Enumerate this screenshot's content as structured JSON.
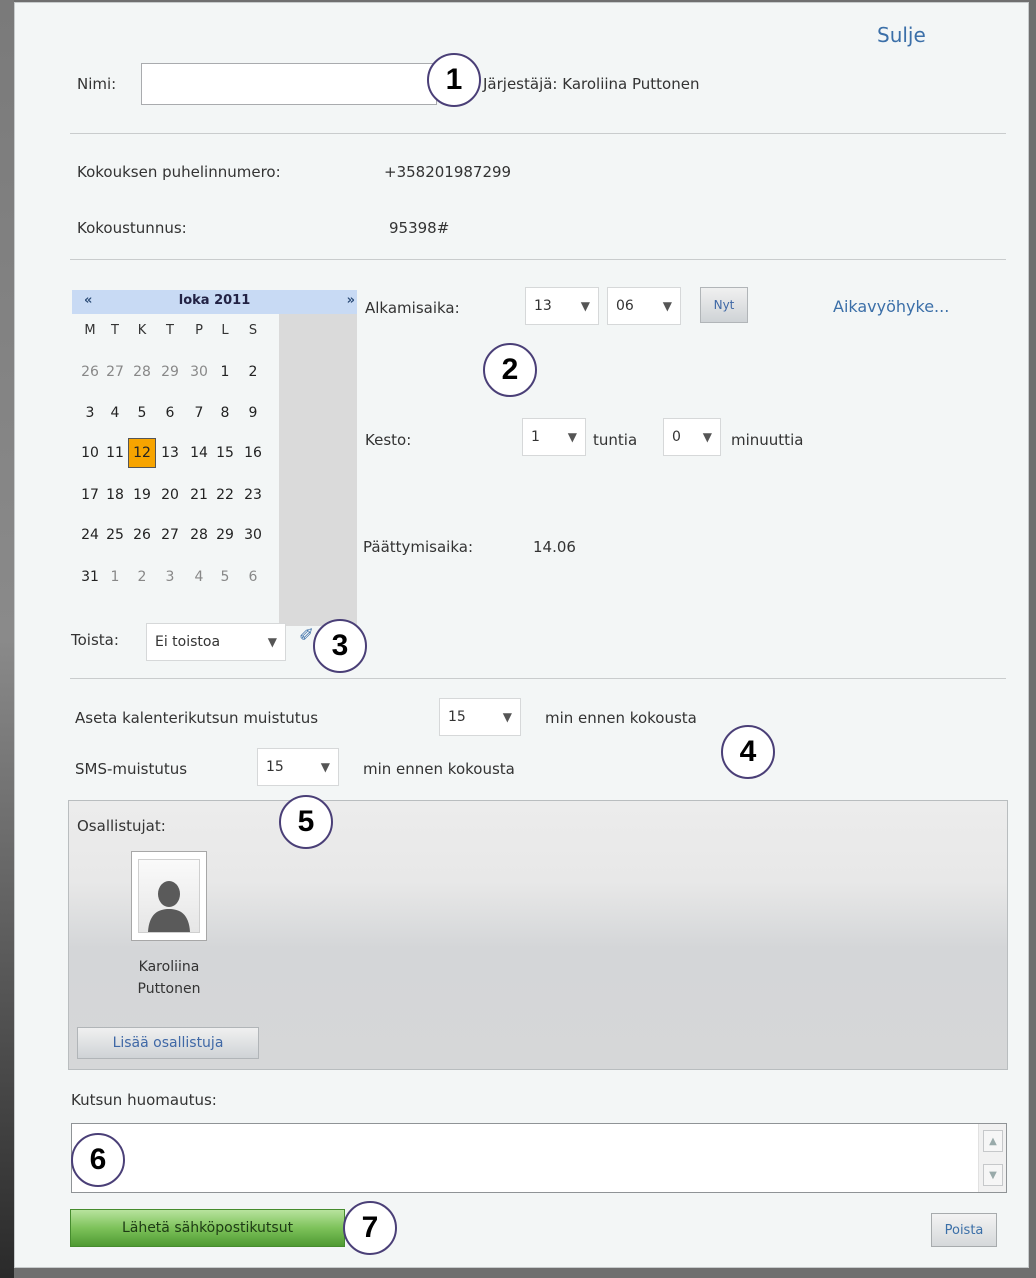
{
  "header": {
    "close_link": "Sulje"
  },
  "name": {
    "label": "Nimi:",
    "value": "",
    "organizer": "Järjestäjä: Karoliina Puttonen"
  },
  "meeting": {
    "phone_label": "Kokouksen puhelinnumero:",
    "phone_value": "+358201987299",
    "code_label": "Kokoustunnus:",
    "code_value": "95398#"
  },
  "calendar": {
    "prev": "«",
    "next": "»",
    "month_title": "loka 2011",
    "weekdays": [
      "M",
      "T",
      "K",
      "T",
      "P",
      "L",
      "S"
    ],
    "weeks": [
      [
        "26",
        "27",
        "28",
        "29",
        "30",
        "1",
        "2"
      ],
      [
        "3",
        "4",
        "5",
        "6",
        "7",
        "8",
        "9"
      ],
      [
        "10",
        "11",
        "12",
        "13",
        "14",
        "15",
        "16"
      ],
      [
        "17",
        "18",
        "19",
        "20",
        "21",
        "22",
        "23"
      ],
      [
        "24",
        "25",
        "26",
        "27",
        "28",
        "29",
        "30"
      ],
      [
        "31",
        "1",
        "2",
        "3",
        "4",
        "5",
        "6"
      ]
    ],
    "selected_day": "12"
  },
  "time": {
    "start_label": "Alkamisaika:",
    "start_hour": "13",
    "start_minute": "06",
    "now_button": "Nyt",
    "timezone_link": "Aikavyöhyke...",
    "duration_label": "Kesto:",
    "duration_hours": "1",
    "hours_unit": "tuntia",
    "duration_minutes": "0",
    "minutes_unit": "minuuttia",
    "end_label": "Päättymisaika:",
    "end_value": "14.06"
  },
  "repeat": {
    "label": "Toista:",
    "value": "Ei toistoa"
  },
  "reminders": {
    "calendar_label": "Aseta kalenterikutsun muistutus",
    "calendar_value": "15",
    "calendar_suffix": "min ennen kokousta",
    "sms_label": "SMS-muistutus",
    "sms_value": "15",
    "sms_suffix": "min ennen kokousta"
  },
  "participants": {
    "label": "Osallistujat:",
    "people": [
      {
        "first": "Karoliina",
        "last": "Puttonen"
      }
    ],
    "add_button": "Lisää osallistuja"
  },
  "note": {
    "label": "Kutsun huomautus:",
    "value": ""
  },
  "actions": {
    "send": "Lähetä sähköpostikutsut",
    "delete": "Poista"
  },
  "callouts": [
    "1",
    "2",
    "3",
    "4",
    "5",
    "6",
    "7"
  ]
}
